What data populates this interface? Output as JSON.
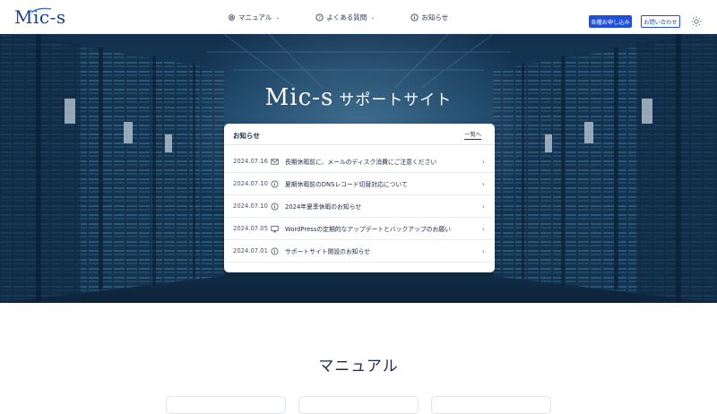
{
  "header": {
    "logo_text": "Mic-s",
    "nav": [
      {
        "label": "マニュアル",
        "icon": "gear-icon",
        "has_dropdown": true
      },
      {
        "label": "よくある質問",
        "icon": "question-icon",
        "has_dropdown": true
      },
      {
        "label": "お知らせ",
        "icon": "info-icon",
        "has_dropdown": false
      }
    ],
    "apply_button": "各種お申し込み",
    "contact_button": "お問い合わせ",
    "theme_icon": "sun-icon"
  },
  "hero": {
    "brand": "Mic-s",
    "subtitle": "サポートサイト"
  },
  "news": {
    "title": "お知らせ",
    "view_all": "一覧へ",
    "items": [
      {
        "date": "2024.07.16",
        "icon": "mail-icon",
        "text": "長期休暇前に、メールのディスク消費にご注意ください"
      },
      {
        "date": "2024.07.10",
        "icon": "info-icon",
        "text": "夏期休暇前のDNSレコード切替対応について"
      },
      {
        "date": "2024.07.10",
        "icon": "info-icon",
        "text": "2024年夏季休暇のお知らせ"
      },
      {
        "date": "2024.07.05",
        "icon": "monitor-icon",
        "text": "WordPressの定期的なアップデートとバックアップのお願い"
      },
      {
        "date": "2024.07.01",
        "icon": "info-icon",
        "text": "サポートサイト開設のお知らせ"
      }
    ]
  },
  "manual": {
    "title": "マニュアル"
  },
  "colors": {
    "brand": "#1b3d8f",
    "accent": "#1e4fd6"
  }
}
